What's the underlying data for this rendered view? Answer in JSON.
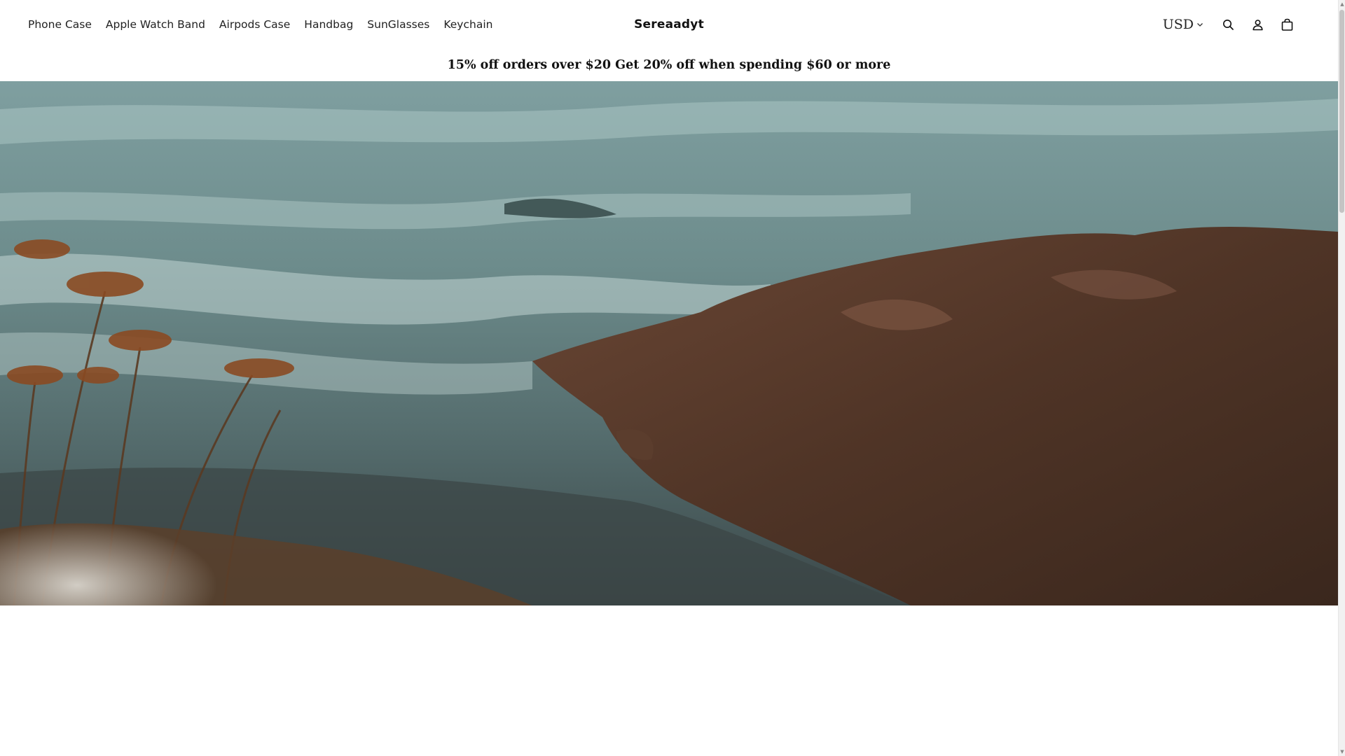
{
  "header": {
    "nav": [
      {
        "label": "Phone Case"
      },
      {
        "label": "Apple Watch Band"
      },
      {
        "label": "Airpods Case"
      },
      {
        "label": "Handbag"
      },
      {
        "label": "SunGlasses"
      },
      {
        "label": "Keychain"
      }
    ],
    "logo": "Sereaadyt",
    "currency": "USD",
    "icons": {
      "currency_toggle": "chevron-down-icon",
      "search": "search-icon",
      "account": "user-icon",
      "cart": "bag-icon"
    }
  },
  "announcement": {
    "text": "15% off orders over $20 Get 20% off when spending $60 or more"
  },
  "hero": {
    "image": "coastal-rocks-and-sea-photo"
  },
  "colors": {
    "background": "#ffffff",
    "text": "#111111",
    "sea": "#6f8f8f",
    "rock": "#5a3a2a"
  }
}
